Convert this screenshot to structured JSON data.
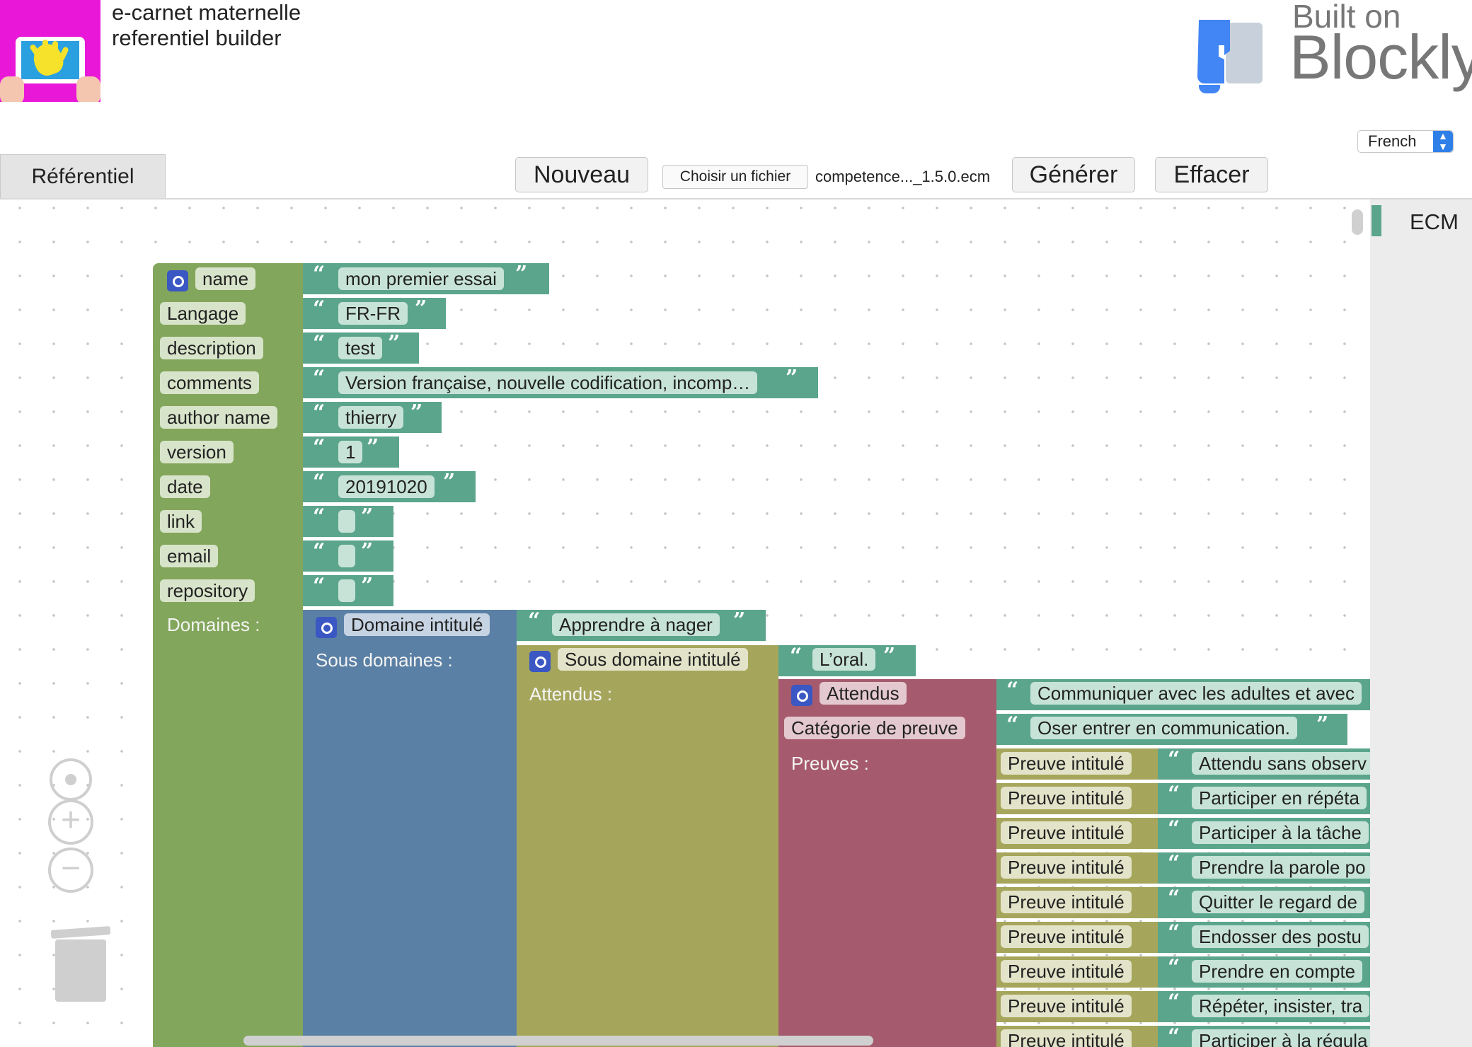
{
  "header": {
    "title_line1": "e-carnet maternelle",
    "title_line2": "referentiel builder",
    "built_on": "Built on",
    "blockly": "Blockly"
  },
  "toolbar": {
    "tab_label": "Référentiel",
    "new_label": "Nouveau",
    "file_button_label": "Choisir un fichier",
    "file_name": "competence..._1.5.0.ecm",
    "generate_label": "Générer",
    "clear_label": "Effacer",
    "language": "French"
  },
  "flyout": {
    "category": "ECM"
  },
  "fields": [
    {
      "label": "name",
      "value": "mon premier essai"
    },
    {
      "label": "Langage",
      "value": "FR-FR"
    },
    {
      "label": "description",
      "value": "test"
    },
    {
      "label": "comments",
      "value": "Version française, nouvelle codification, incomp…"
    },
    {
      "label": "author name",
      "value": "thierry"
    },
    {
      "label": "version",
      "value": "1"
    },
    {
      "label": "date",
      "value": "20191020"
    },
    {
      "label": "link",
      "value": ""
    },
    {
      "label": "email",
      "value": ""
    },
    {
      "label": "repository",
      "value": ""
    }
  ],
  "domaines": {
    "label": "Domaines :",
    "domaine_label": "Domaine intitulé",
    "domaine_value": "Apprendre à nager",
    "sous_label": "Sous domaines :",
    "sous_domaine_label": "Sous domaine intitulé",
    "sous_domaine_value": "L’oral.",
    "attendus_label": "Attendus :",
    "attendus_block": "Attendus",
    "attendus_value": "Communiquer avec les adultes et avec",
    "categorie_label": "Catégorie de preuve",
    "categorie_value": "Oser entrer en communication.",
    "preuves_label": "Preuves :",
    "preuves": [
      {
        "label": "Preuve intitulé",
        "value": "Attendu sans observ"
      },
      {
        "label": "Preuve intitulé",
        "value": "Participer en répéta"
      },
      {
        "label": "Preuve intitulé",
        "value": "Participer à la tâche"
      },
      {
        "label": "Preuve intitulé",
        "value": "Prendre la parole po"
      },
      {
        "label": "Preuve intitulé",
        "value": "Quitter le regard de"
      },
      {
        "label": "Preuve intitulé",
        "value": "Endosser des postu"
      },
      {
        "label": "Preuve intitulé",
        "value": "Prendre en compte"
      },
      {
        "label": "Preuve intitulé",
        "value": "Répéter, insister, tra"
      },
      {
        "label": "Preuve intitulé",
        "value": "Participer à la régula"
      }
    ]
  },
  "colors": {
    "logo_bg": "#e918d8",
    "root_block": "#82a65b",
    "domaine_block": "#5b80a5",
    "sous_domaine_block": "#a5a65b",
    "attendus_block": "#a55b6d",
    "text_block": "#5ba58c",
    "blockly_logo": "#4285f4"
  }
}
